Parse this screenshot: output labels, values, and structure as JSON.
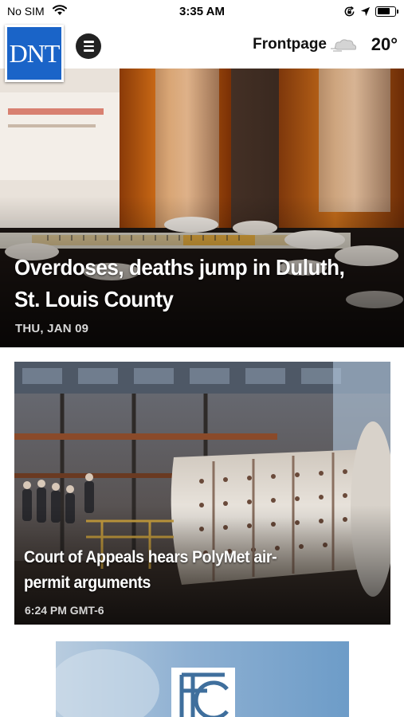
{
  "status_bar": {
    "carrier": "No SIM",
    "time": "3:35 AM",
    "battery_level": 0.75
  },
  "header": {
    "logo_text": "DNT",
    "section": "Frontpage",
    "temperature": "20°",
    "weather_icon": "cloudy-wind-icon",
    "brand_color": "#1a64c8"
  },
  "lead_story": {
    "headline_line1": "Overdoses, deaths jump in Duluth,",
    "headline_line2": "St. Louis County",
    "date": "THU, JAN 09"
  },
  "story": {
    "headline_line1": "Court of Appeals hears PolyMet air-",
    "headline_line2": "permit arguments",
    "time": "6:24 PM GMT-6"
  }
}
